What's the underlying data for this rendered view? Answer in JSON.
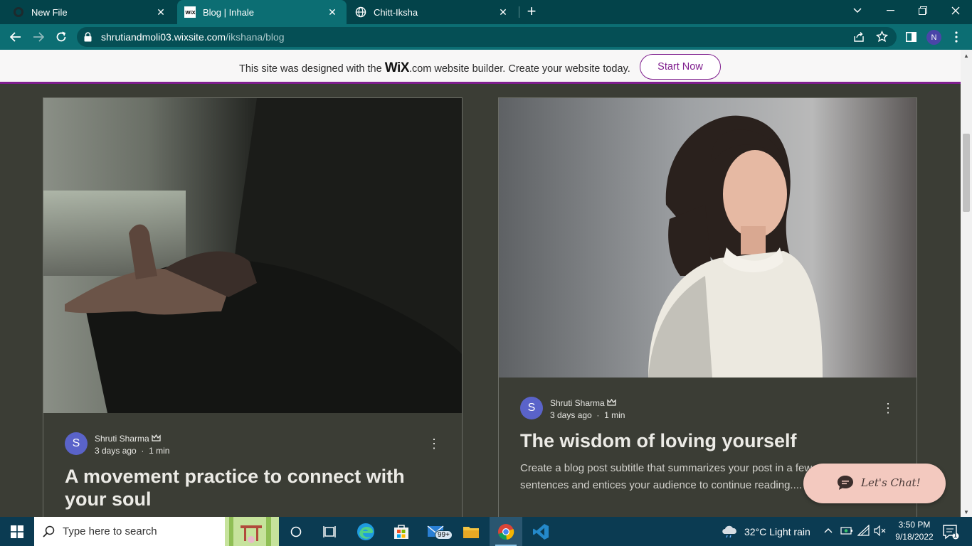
{
  "browser": {
    "tabs": [
      {
        "title": "New File",
        "favicon": "github-icon"
      },
      {
        "title": "Blog | Inhale",
        "favicon": "wix-icon"
      },
      {
        "title": "Chitt-Iksha",
        "favicon": "globe-icon"
      }
    ],
    "url_host": "shrutiandmoli03.wixsite.com",
    "url_path": "/ikshana/blog",
    "profile_initial": "N"
  },
  "wix_banner": {
    "text_before": "This site was designed with the ",
    "logo": "WiX",
    "text_after": ".com website builder. Create your website today.",
    "cta": "Start Now"
  },
  "posts": [
    {
      "author_initial": "S",
      "author": "Shruti Sharma",
      "date": "3 days ago",
      "separator": "·",
      "read_time": "1 min",
      "title": "A movement practice to connect with your soul",
      "subtitle": ""
    },
    {
      "author_initial": "S",
      "author": "Shruti Sharma",
      "date": "3 days ago",
      "separator": "·",
      "read_time": "1 min",
      "title": "The wisdom of loving yourself",
      "subtitle": "Create a blog post subtitle that summarizes your post in a few sentences and entices your audience to continue reading...."
    }
  ],
  "chat": {
    "label": "Let's Chat!"
  },
  "taskbar": {
    "search_placeholder": "Type here to search",
    "mail_badge": "99+",
    "weather": "32°C  Light rain",
    "time": "3:50 PM",
    "date": "9/18/2022",
    "notification_count": "1"
  },
  "colors": {
    "tab_strip": "#03434a",
    "toolbar": "#0c6e73",
    "page_bg": "#3b3d35",
    "wix_accent": "#7f1e8e",
    "author_avatar": "#5a63c9",
    "chat_bg": "#f3c9bf"
  }
}
